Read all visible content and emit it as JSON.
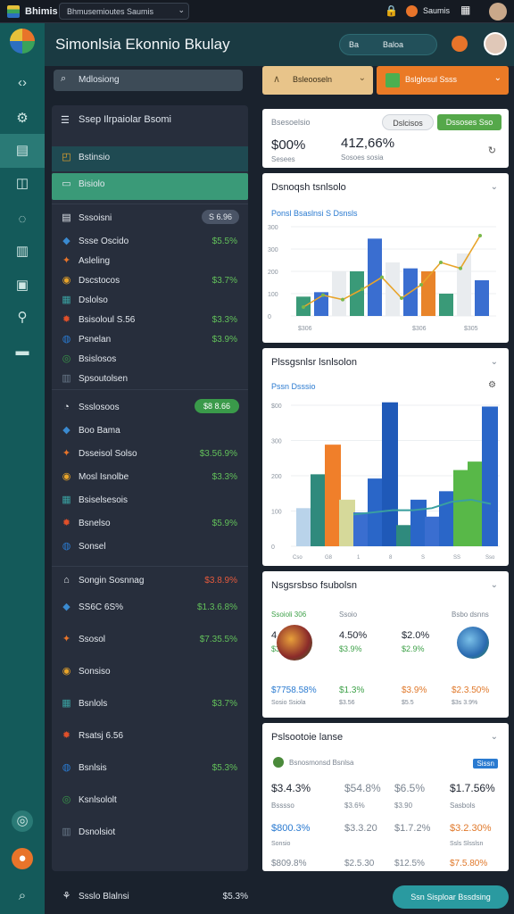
{
  "topbar": {
    "app_name": "Bhimis",
    "search_text": "Bhmusemioutes Saumis",
    "user_label": "Saumis"
  },
  "header": {
    "title": "Simonlsia Ekonnio Bkulay",
    "toggle_label": "Ba",
    "toggle_option": "Baloa"
  },
  "left": {
    "search_placeholder": "Mdlosiong",
    "panel1_title": "Ssep Ilrpaiolar Bsomi",
    "nav_active1": "Bstinsio",
    "nav_active2": "Bisiolo",
    "section1": {
      "label": "Sssoisni",
      "badge": "S 6.96"
    },
    "items1": [
      {
        "label": "Ssse Oscido",
        "value": "$5.5%"
      },
      {
        "label": "Asleling",
        "value": ""
      },
      {
        "label": "Dscstocos",
        "value": "$3.7%"
      },
      {
        "label": "Dslolso",
        "value": ""
      },
      {
        "label": "Bsisoloul S.56",
        "value": "$3.3%"
      },
      {
        "label": "Psnelan",
        "value": "$3.9%"
      },
      {
        "label": "Bsislosos",
        "value": ""
      },
      {
        "label": "Spsoutolsen",
        "value": ""
      }
    ],
    "section2": {
      "label": "Ssslosoos",
      "badge": "$8 8.66"
    },
    "items2": [
      {
        "label": "Boo Bama",
        "value": ""
      },
      {
        "label": "Dsseisol Solso",
        "value": "$3.56.9%"
      },
      {
        "label": "Mosl Isnolbe",
        "value": "$3.3%"
      },
      {
        "label": "Bsiselsesois",
        "value": ""
      },
      {
        "label": "Bsnelso",
        "value": "$5.9%"
      },
      {
        "label": "Sonsel",
        "value": ""
      }
    ],
    "section3": {
      "label": "Songin Sosnnag",
      "value": "$3.8.9%"
    },
    "items3": [
      {
        "label": "SS6C 6S%",
        "value": "$1.3.6.8%"
      },
      {
        "label": "Ssosol",
        "value": "$7.35.5%"
      },
      {
        "label": "Sonsiso",
        "value": ""
      },
      {
        "label": "Bsnlols",
        "value": "$3.7%"
      },
      {
        "label": "Rsatsj 6.56",
        "value": ""
      },
      {
        "label": "Bsnlsis",
        "value": "$5.3%"
      },
      {
        "label": "Ksnlsololt",
        "value": ""
      },
      {
        "label": "Dsnolsiot",
        "value": ""
      }
    ],
    "footer_label": "Ssslo Blalnsi",
    "footer_value": "$5.3%"
  },
  "right": {
    "select_label": "Bsleooseln",
    "action_label": "Bslglosul Ssss",
    "summary": {
      "label": "Bsesoelsio",
      "big_left": "$00%",
      "big_right": "41Z,66%",
      "sub_left": "Sesees",
      "sub_right": "Sosoes sosia",
      "btn1": "Dslcisos",
      "btn2": "Dssoses Sso"
    },
    "chart1": {
      "title": "Dsnoqsh tsnlsolo"
    },
    "chart2": {
      "title": "Plssgsnlsr lsnlsolon"
    },
    "card3": {
      "title": "Nsgsrsbso fsubolsn"
    },
    "card4": {
      "title": "Pslsootoie lanse"
    },
    "bottom_button": "Ssn Sisploar Bssdsing"
  },
  "chart_data": [
    {
      "type": "bar",
      "title": "Dsnoqsh tsnlsolo",
      "legend": "Ponsl Bsaslnsi S Dsnsls",
      "categories": [
        "$306",
        "$306",
        "$305"
      ],
      "yticks": [
        "300",
        "300",
        "200",
        "100",
        "0"
      ],
      "series": [
        {
          "name": "A",
          "color": "#3a9a78",
          "values": [
            65,
            50,
            150,
            75
          ]
        },
        {
          "name": "B",
          "color": "#3a6ed0",
          "values": [
            80,
            120,
            260,
            160
          ]
        },
        {
          "name": "C",
          "color": "#e9ecef",
          "values": [
            110,
            150,
            180,
            210
          ]
        },
        {
          "name": "D",
          "color": "#e8842a",
          "values": [
            0,
            0,
            0,
            150
          ]
        }
      ],
      "line": [
        30,
        70,
        55,
        90,
        130,
        60,
        105,
        180,
        160,
        270
      ]
    },
    {
      "type": "bar",
      "title": "Plssgsnlsr lsnlsolon",
      "legend": "Pssn Dsssio",
      "yticks": [
        "$00",
        "300",
        "200",
        "100",
        "0"
      ],
      "values": [
        90,
        170,
        240,
        110,
        80,
        160,
        340,
        50,
        110,
        70,
        130,
        180,
        200,
        330
      ],
      "colors": [
        "#b9d3ea",
        "#2f8a7d",
        "#f07f2a",
        "#d6d99a",
        "#3a6ed0",
        "#2a66c8",
        "#1f59b8",
        "#2f8a7d",
        "#2a66c8",
        "#3a6ed0",
        "#2a66c8",
        "#58b848",
        "#58b848",
        "#2a66c8"
      ],
      "line": [
        150,
        160,
        170,
        170,
        180,
        210,
        220,
        200
      ]
    }
  ],
  "card3_cols": [
    {
      "head": "Ssoioli 306",
      "v1": "4.50%",
      "v2": "$3.9%",
      "total": "$7758.58%",
      "total2": "Sosio Ssiola"
    },
    {
      "head": "Ssoio",
      "v1": "4.50%",
      "v2": "$3.9%",
      "total": "$1.3%",
      "total2": "$3.56"
    },
    {
      "head": "",
      "v1": "$2.0%",
      "v2": "$2.9%",
      "total": "$3.9%",
      "total2": "$5.5"
    },
    {
      "head": "Bsbo dsnns",
      "v1": "",
      "v2": "",
      "total": "$2.3.50%",
      "total2": "$3s 3.9%"
    }
  ],
  "card4_head": {
    "label": "Bsnosmonsd Bsnlsa",
    "tag": "Sissn"
  },
  "card4_rows": [
    [
      "$3.4.3%",
      "$54.8%",
      "$6.5%",
      "$1.7.56%"
    ],
    [
      "Bsssso",
      "$3.6%",
      "$3.90",
      "Sasbols"
    ],
    [
      "$800.3%",
      "$3.3.20",
      "$1.7.2%",
      "$3.2.30%"
    ],
    [
      "Sonsio",
      "",
      "",
      "Ssls Slsslsn"
    ],
    [
      "$809.8%",
      "$2.5.30",
      "$12.5%",
      "$7.5.80%"
    ]
  ]
}
